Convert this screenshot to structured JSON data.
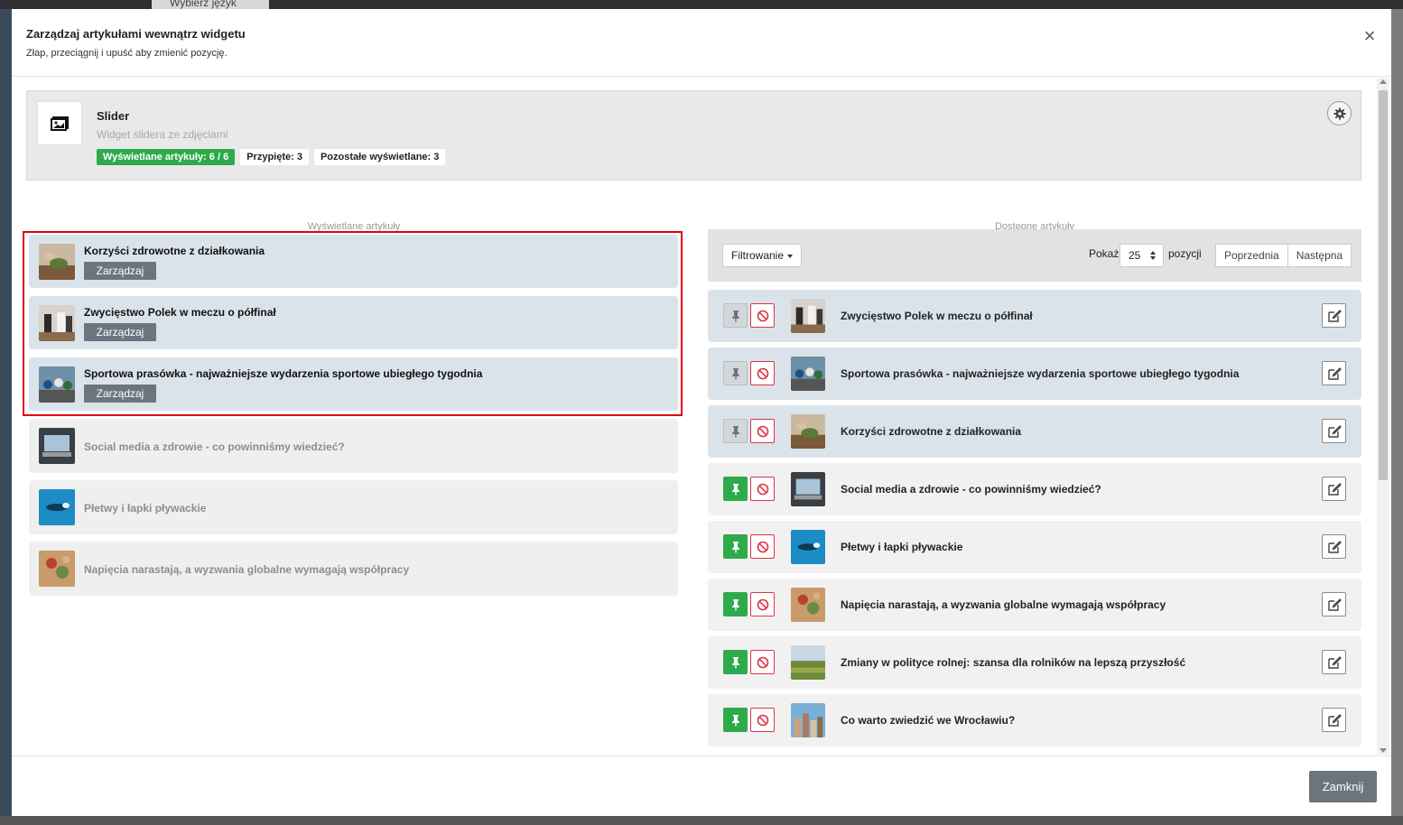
{
  "background": {
    "language_selector": "Wybierz język"
  },
  "modal": {
    "title": "Zarządzaj artykułami wewnątrz widgetu",
    "subtitle": "Złap, przeciągnij i upuść aby zmienić pozycję.",
    "close_icon": "×"
  },
  "widget": {
    "name": "Slider",
    "description": "Widget slidera ze zdjęciami",
    "badges": {
      "displayed": "Wyświetlane artykuły: 6 / 6",
      "pinned": "Przypięte: 3",
      "remaining": "Pozostałe wyświetlane: 3"
    }
  },
  "left_column": {
    "title": "Wyświetlane artykuły",
    "manage_label": "Zarządzaj",
    "items": [
      {
        "title": "Korzyści zdrowotne z działkowania",
        "state": "active",
        "thumb": "garden"
      },
      {
        "title": "Zwycięstwo Polek w meczu o półfinał",
        "state": "active",
        "thumb": "match"
      },
      {
        "title": "Sportowa prasówka - najważniejsze wydarzenia sportowe ubiegłego tygodnia",
        "state": "active",
        "thumb": "cycling"
      },
      {
        "title": "Social media a zdrowie - co powinniśmy wiedzieć?",
        "state": "inactive",
        "thumb": "laptop"
      },
      {
        "title": "Płetwy i łapki pływackie",
        "state": "inactive",
        "thumb": "swim"
      },
      {
        "title": "Napięcia narastają, a wyzwania globalne wymagają współpracy",
        "state": "inactive",
        "thumb": "map"
      }
    ]
  },
  "right_column": {
    "title": "Dostępne artykuły",
    "filter_label": "Filtrowanie",
    "show_label": "Pokaż",
    "page_size": "25",
    "positions_label": "pozycji",
    "prev_label": "Poprzednia",
    "next_label": "Następna",
    "items": [
      {
        "title": "Zwycięstwo Polek w meczu o półfinał",
        "pinned": false,
        "state": "active",
        "thumb": "match"
      },
      {
        "title": "Sportowa prasówka - najważniejsze wydarzenia sportowe ubiegłego tygodnia",
        "pinned": false,
        "state": "active",
        "thumb": "cycling"
      },
      {
        "title": "Korzyści zdrowotne z działkowania",
        "pinned": false,
        "state": "active",
        "thumb": "garden"
      },
      {
        "title": "Social media a zdrowie - co powinniśmy wiedzieć?",
        "pinned": true,
        "state": "normal",
        "thumb": "laptop"
      },
      {
        "title": "Płetwy i łapki pływackie",
        "pinned": true,
        "state": "normal",
        "thumb": "swim"
      },
      {
        "title": "Napięcia narastają, a wyzwania globalne wymagają współpracy",
        "pinned": true,
        "state": "normal",
        "thumb": "map"
      },
      {
        "title": "Zmiany w polityce rolnej: szansa dla rolników na lepszą przyszłość",
        "pinned": true,
        "state": "normal",
        "thumb": "field"
      },
      {
        "title": "Co warto zwiedzić we Wrocławiu?",
        "pinned": true,
        "state": "normal",
        "thumb": "city"
      }
    ]
  },
  "footer": {
    "close_label": "Zamknij"
  },
  "colors": {
    "accent_green": "#2faa4b",
    "danger_red": "#dc3545",
    "secondary_gray": "#6c757d",
    "highlight_frame": "#e00012"
  }
}
